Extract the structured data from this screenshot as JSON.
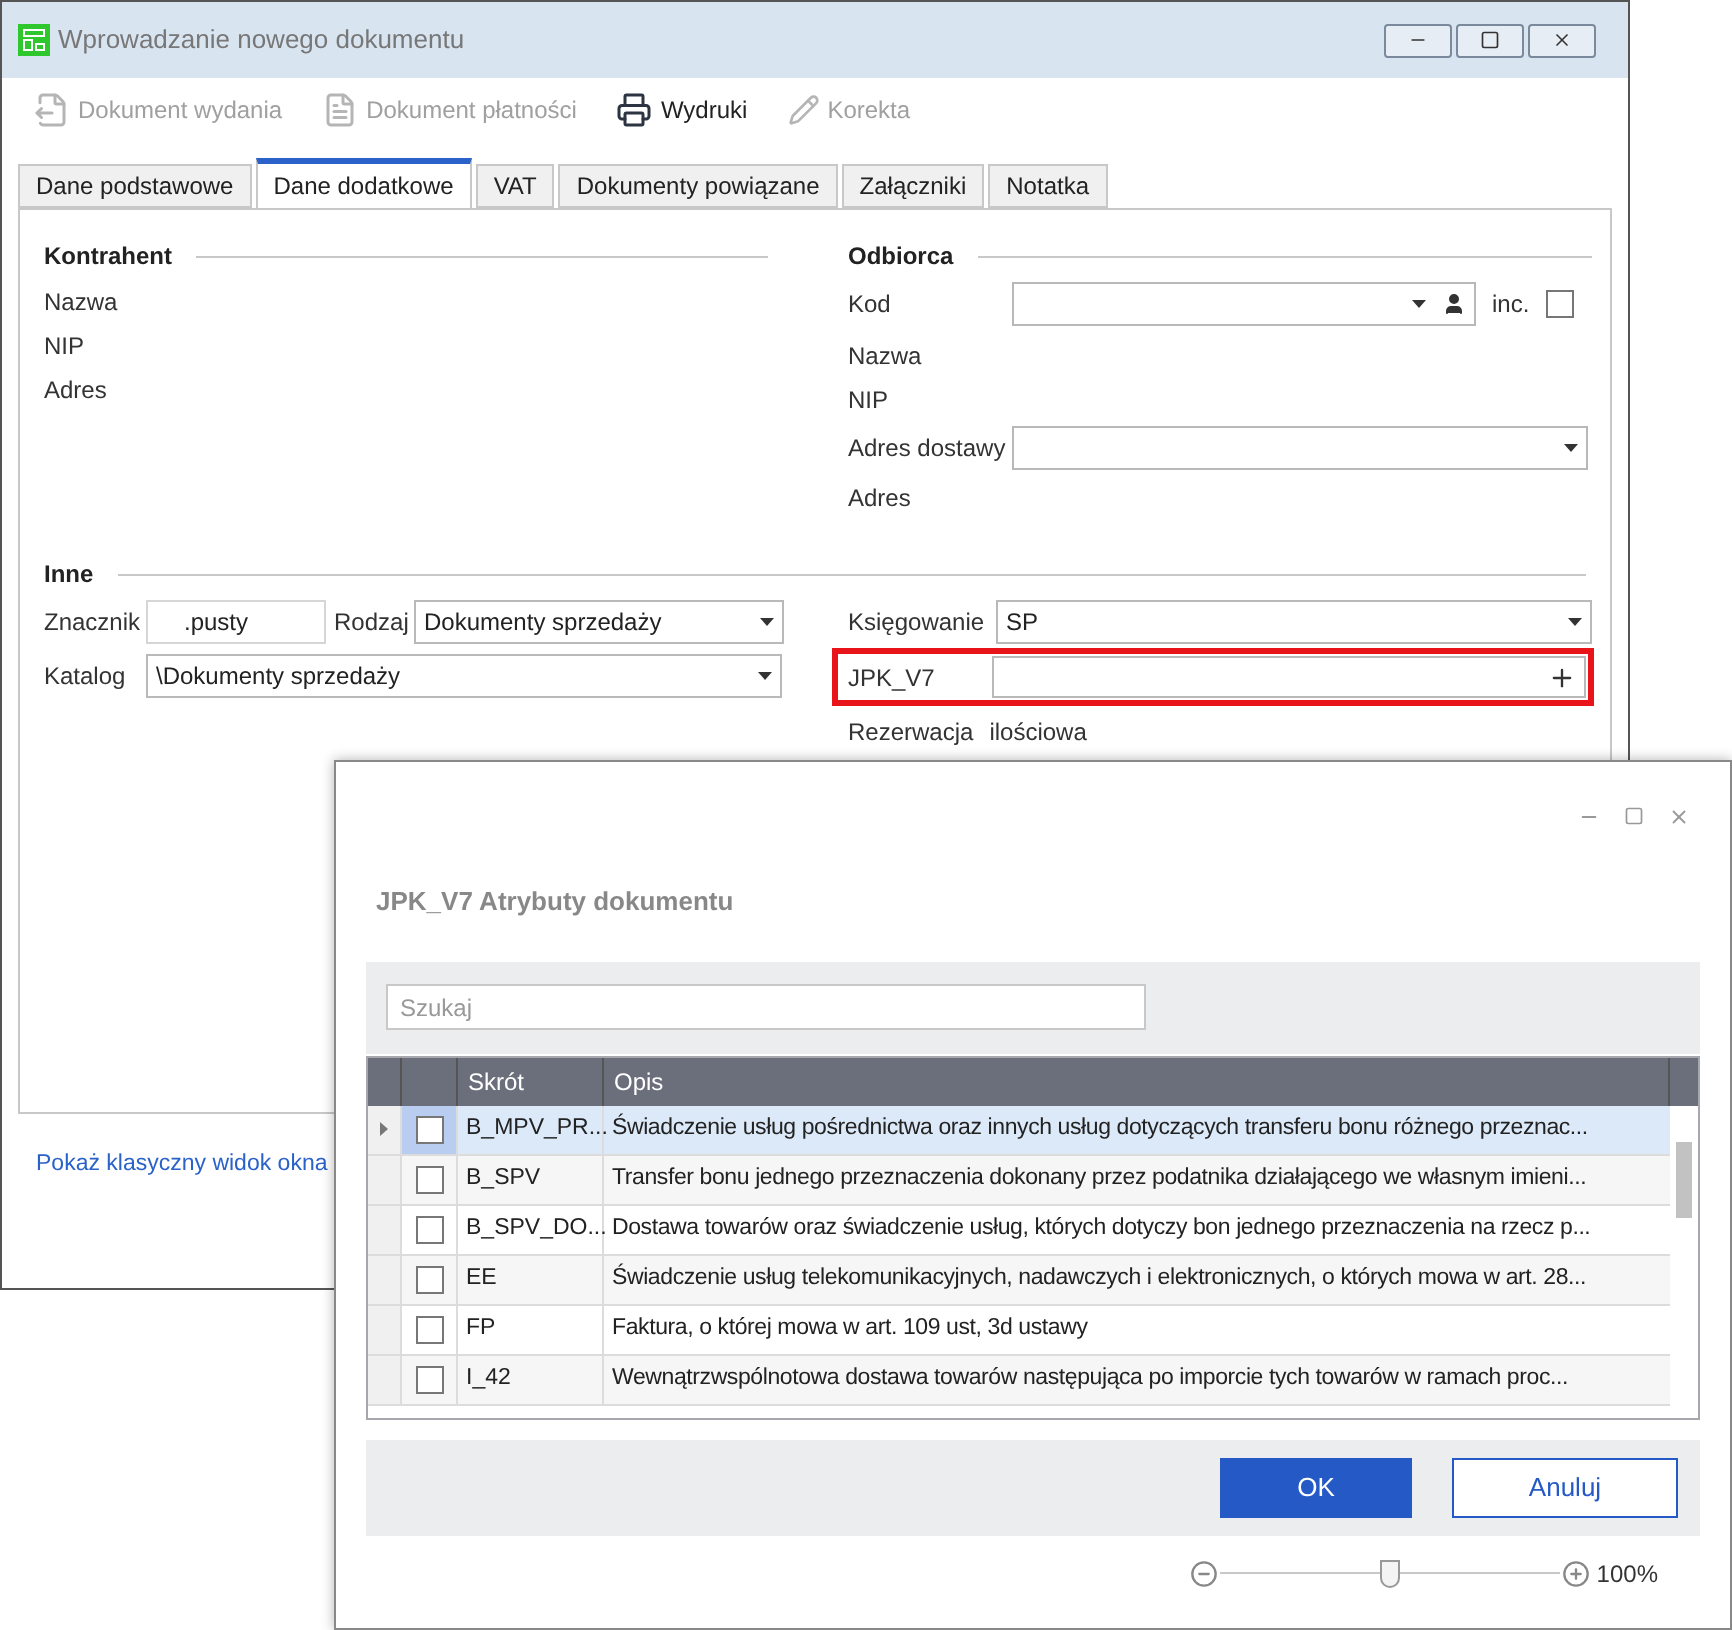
{
  "main_window": {
    "title": "Wprowadzanie nowego dokumentu",
    "toolbar": [
      {
        "label": "Dokument wydania",
        "disabled": true,
        "kind": "issue"
      },
      {
        "label": "Dokument płatności",
        "disabled": true,
        "kind": "payment"
      },
      {
        "label": "Wydruki",
        "disabled": false,
        "kind": "print"
      },
      {
        "label": "Korekta",
        "disabled": true,
        "kind": "edit"
      }
    ],
    "tabs": [
      {
        "label": "Dane podstawowe",
        "selected": false
      },
      {
        "label": "Dane dodatkowe",
        "selected": true
      },
      {
        "label": "VAT",
        "selected": false
      },
      {
        "label": "Dokumenty powiązane",
        "selected": false
      },
      {
        "label": "Załączniki",
        "selected": false
      },
      {
        "label": "Notatka",
        "selected": false
      }
    ],
    "contractor": {
      "heading": "Kontrahent",
      "fields": [
        "Nazwa",
        "NIP",
        "Adres"
      ]
    },
    "recipient": {
      "heading": "Odbiorca",
      "code_label": "Kod",
      "inc_label": "inc.",
      "inc_checked": false,
      "name_label": "Nazwa",
      "nip_label": "NIP",
      "delivery_label": "Adres dostawy",
      "address_label": "Adres"
    },
    "other": {
      "heading": "Inne",
      "tag_label": "Znacznik",
      "tag_value": ".pusty",
      "type_label": "Rodzaj",
      "type_value": "Dokumenty sprzedaży",
      "catalog_label": "Katalog",
      "catalog_value": "\\Dokumenty sprzedaży",
      "booking_label": "Księgowanie",
      "booking_value": "SP",
      "jpk_label": "JPK_V7",
      "reservation_label": "Rezerwacja",
      "reservation_value": "ilościowa"
    },
    "footer_link": "Pokaż klasyczny widok okna"
  },
  "dialog": {
    "heading": "JPK_V7 Atrybuty dokumentu",
    "search": {
      "placeholder": "Szukaj"
    },
    "table": {
      "columns": [
        "Skrót",
        "Opis"
      ],
      "rows": [
        {
          "code": "B_MPV_PR...",
          "description": "Świadczenie usług pośrednictwa oraz innych usług dotyczących transferu bonu różnego przeznac...",
          "checked": false,
          "selected": true
        },
        {
          "code": "B_SPV",
          "description": "Transfer bonu jednego przeznaczenia dokonany przez podatnika działającego we własnym imieni...",
          "checked": false,
          "selected": false
        },
        {
          "code": "B_SPV_DO...",
          "description": "Dostawa towarów oraz świadczenie usług, których dotyczy bon jednego przeznaczenia na rzecz p...",
          "checked": false,
          "selected": false
        },
        {
          "code": "EE",
          "description": "Świadczenie usług telekomunikacyjnych, nadawczych i elektronicznych, o których mowa w art. 28...",
          "checked": false,
          "selected": false
        },
        {
          "code": "FP",
          "description": "Faktura, o której mowa w art. 109 ust, 3d ustawy",
          "checked": false,
          "selected": false
        },
        {
          "code": "I_42",
          "description": "Wewnątrzwspólnotowa dostawa towarów następująca po imporcie tych towarów w ramach proc...",
          "checked": false,
          "selected": false
        }
      ]
    },
    "buttons": [
      {
        "label": "OK",
        "kind": "primary"
      },
      {
        "label": "Anuluj",
        "kind": "secondary"
      }
    ],
    "zoom": {
      "level": 0.5,
      "reading": "100%"
    }
  }
}
